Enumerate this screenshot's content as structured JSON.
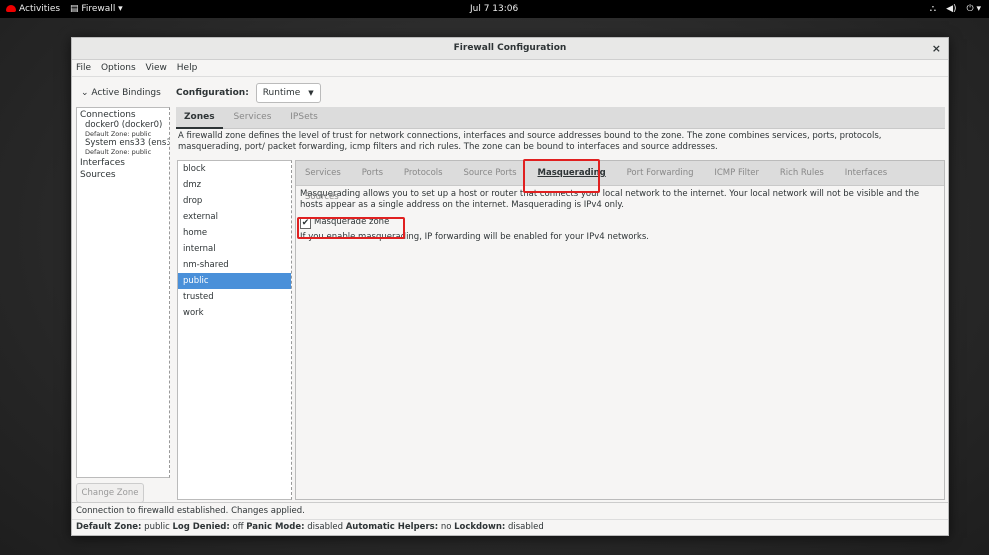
{
  "topbar": {
    "activities": "Activities",
    "app_menu": "Firewall ▾",
    "clock": "Jul 7  13:06"
  },
  "window": {
    "title": "Firewall Configuration"
  },
  "menu": [
    "File",
    "Options",
    "View",
    "Help"
  ],
  "left": {
    "active_bindings": "Active Bindings",
    "connections_label": "Connections",
    "connections": [
      {
        "name": "docker0 (docker0)",
        "sub": "Default Zone: public"
      },
      {
        "name": "System ens33 (ens3",
        "sub": "Default Zone: public"
      }
    ],
    "interfaces_label": "Interfaces",
    "sources_label": "Sources",
    "change_zone": "Change Zone"
  },
  "config": {
    "label": "Configuration:",
    "value": "Runtime"
  },
  "main_tabs": [
    "Zones",
    "Services",
    "IPSets"
  ],
  "description": "A firewalld zone defines the level of trust for network connections, interfaces and source addresses bound to the zone. The zone combines services, ports, protocols, masquerading, port/ packet forwarding, icmp filters and rich rules. The zone can be bound to interfaces and source addresses.",
  "zones": [
    "block",
    "dmz",
    "drop",
    "external",
    "home",
    "internal",
    "nm-shared",
    "public",
    "trusted",
    "work"
  ],
  "selected_zone": "public",
  "sub_tabs": [
    "Services",
    "Ports",
    "Protocols",
    "Source Ports",
    "Masquerading",
    "Port Forwarding",
    "ICMP Filter",
    "Rich Rules",
    "Interfaces",
    "Sources"
  ],
  "active_sub_tab": "Masquerading",
  "masquerade": {
    "text": "Masquerading allows you to set up a host or router that connects your local network to the internet. Your local network will not be visible and the hosts appear as a single address on the internet. Masquerading is IPv4 only.",
    "checkbox_label": "Masquerade zone",
    "checked": true,
    "info": "If you enable masquerading, IP forwarding will be enabled for your IPv4 networks."
  },
  "status": {
    "message": "Connection to firewalld established.  Changes applied.",
    "default_zone_label": "Default Zone:",
    "default_zone": "public",
    "log_denied_label": "Log Denied:",
    "log_denied": "off",
    "panic_label": "Panic Mode:",
    "panic": "disabled",
    "helpers_label": "Automatic Helpers:",
    "helpers": "no",
    "lockdown_label": "Lockdown:",
    "lockdown": "disabled"
  },
  "colors": {
    "selection": "#4a90d9",
    "highlight_box": "#e02020"
  }
}
